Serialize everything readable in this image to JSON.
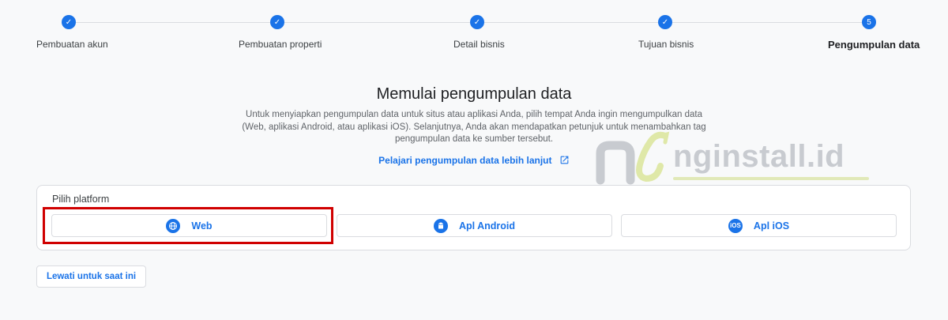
{
  "stepper": {
    "steps": [
      {
        "label": "Pembuatan akun",
        "marker": "✓"
      },
      {
        "label": "Pembuatan properti",
        "marker": "✓"
      },
      {
        "label": "Detail bisnis",
        "marker": "✓"
      },
      {
        "label": "Tujuan bisnis",
        "marker": "✓"
      },
      {
        "label": "Pengumpulan data",
        "marker": "5"
      }
    ]
  },
  "main": {
    "title": "Memulai pengumpulan data",
    "description": "Untuk menyiapkan pengumpulan data untuk situs atau aplikasi Anda, pilih tempat Anda ingin mengumpulkan data (Web, aplikasi Android, atau aplikasi iOS). Selanjutnya, Anda akan mendapatkan petunjuk untuk menambahkan tag pengumpulan data ke sumber tersebut.",
    "learn_link": "Pelajari pengumpulan data lebih lanjut"
  },
  "platform": {
    "title": "Pilih platform",
    "buttons": [
      {
        "label": "Web",
        "icon": "globe-icon"
      },
      {
        "label": "Apl Android",
        "icon": "android-icon"
      },
      {
        "label": "Apl iOS",
        "icon": "ios-icon",
        "icon_text": "iOS"
      }
    ]
  },
  "skip_button": "Lewati untuk saat ini",
  "watermark": {
    "text": "nginstall.id",
    "logo": "ng"
  },
  "colors": {
    "accent": "#1a73e8",
    "highlight": "#d00000",
    "background": "#f8f9fa"
  }
}
